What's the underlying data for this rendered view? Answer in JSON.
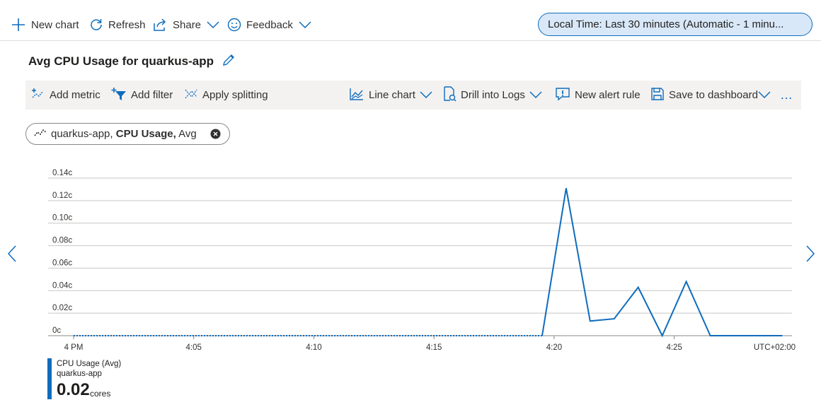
{
  "toolbar": {
    "new_chart": "New chart",
    "refresh": "Refresh",
    "share": "Share",
    "feedback": "Feedback",
    "time_range": "Local Time: Last 30 minutes (Automatic - 1 minu..."
  },
  "chart_title": "Avg CPU Usage for quarkus-app",
  "chart_toolbar": {
    "add_metric": "Add metric",
    "add_filter": "Add filter",
    "apply_splitting": "Apply splitting",
    "line_chart": "Line chart",
    "drill_logs": "Drill into Logs",
    "new_alert": "New alert rule",
    "save_dashboard": "Save to dashboard",
    "more": "…"
  },
  "metric_pill": {
    "resource": "quarkus-app,",
    "metric": "CPU Usage,",
    "aggregation": "Avg"
  },
  "legend": {
    "series_name": "CPU Usage (Avg)",
    "resource": "quarkus-app",
    "value": "0.02",
    "unit": "cores"
  },
  "colors": {
    "accent": "#0f6cbd",
    "line": "#0f6cbd",
    "grid": "#c8c6c4"
  },
  "chart_data": {
    "type": "line",
    "title": "Avg CPU Usage for quarkus-app",
    "xlabel": "",
    "ylabel": "",
    "timezone_label": "UTC+02:00",
    "y_ticks": [
      "0c",
      "0.02c",
      "0.04c",
      "0.06c",
      "0.08c",
      "0.10c",
      "0.12c",
      "0.14c"
    ],
    "ylim": [
      0,
      0.14
    ],
    "x_ticks": [
      {
        "t": 0,
        "label": "4 PM"
      },
      {
        "t": 5,
        "label": "4:05"
      },
      {
        "t": 10,
        "label": "4:10"
      },
      {
        "t": 15,
        "label": "4:15"
      },
      {
        "t": 20,
        "label": "4:20"
      },
      {
        "t": 25,
        "label": "4:25"
      }
    ],
    "xlim": [
      0,
      29.9
    ],
    "no_data_segment": [
      0,
      19.5
    ],
    "series": [
      {
        "name": "CPU Usage (Avg)",
        "points": [
          [
            19.5,
            0
          ],
          [
            20.5,
            0.131
          ],
          [
            21.5,
            0.013
          ],
          [
            22.5,
            0.015
          ],
          [
            23.5,
            0.043
          ],
          [
            24.5,
            0
          ],
          [
            25.5,
            0.048
          ],
          [
            26.5,
            0
          ],
          [
            27.5,
            0
          ],
          [
            28.5,
            0
          ],
          [
            29.5,
            0
          ]
        ]
      }
    ]
  }
}
